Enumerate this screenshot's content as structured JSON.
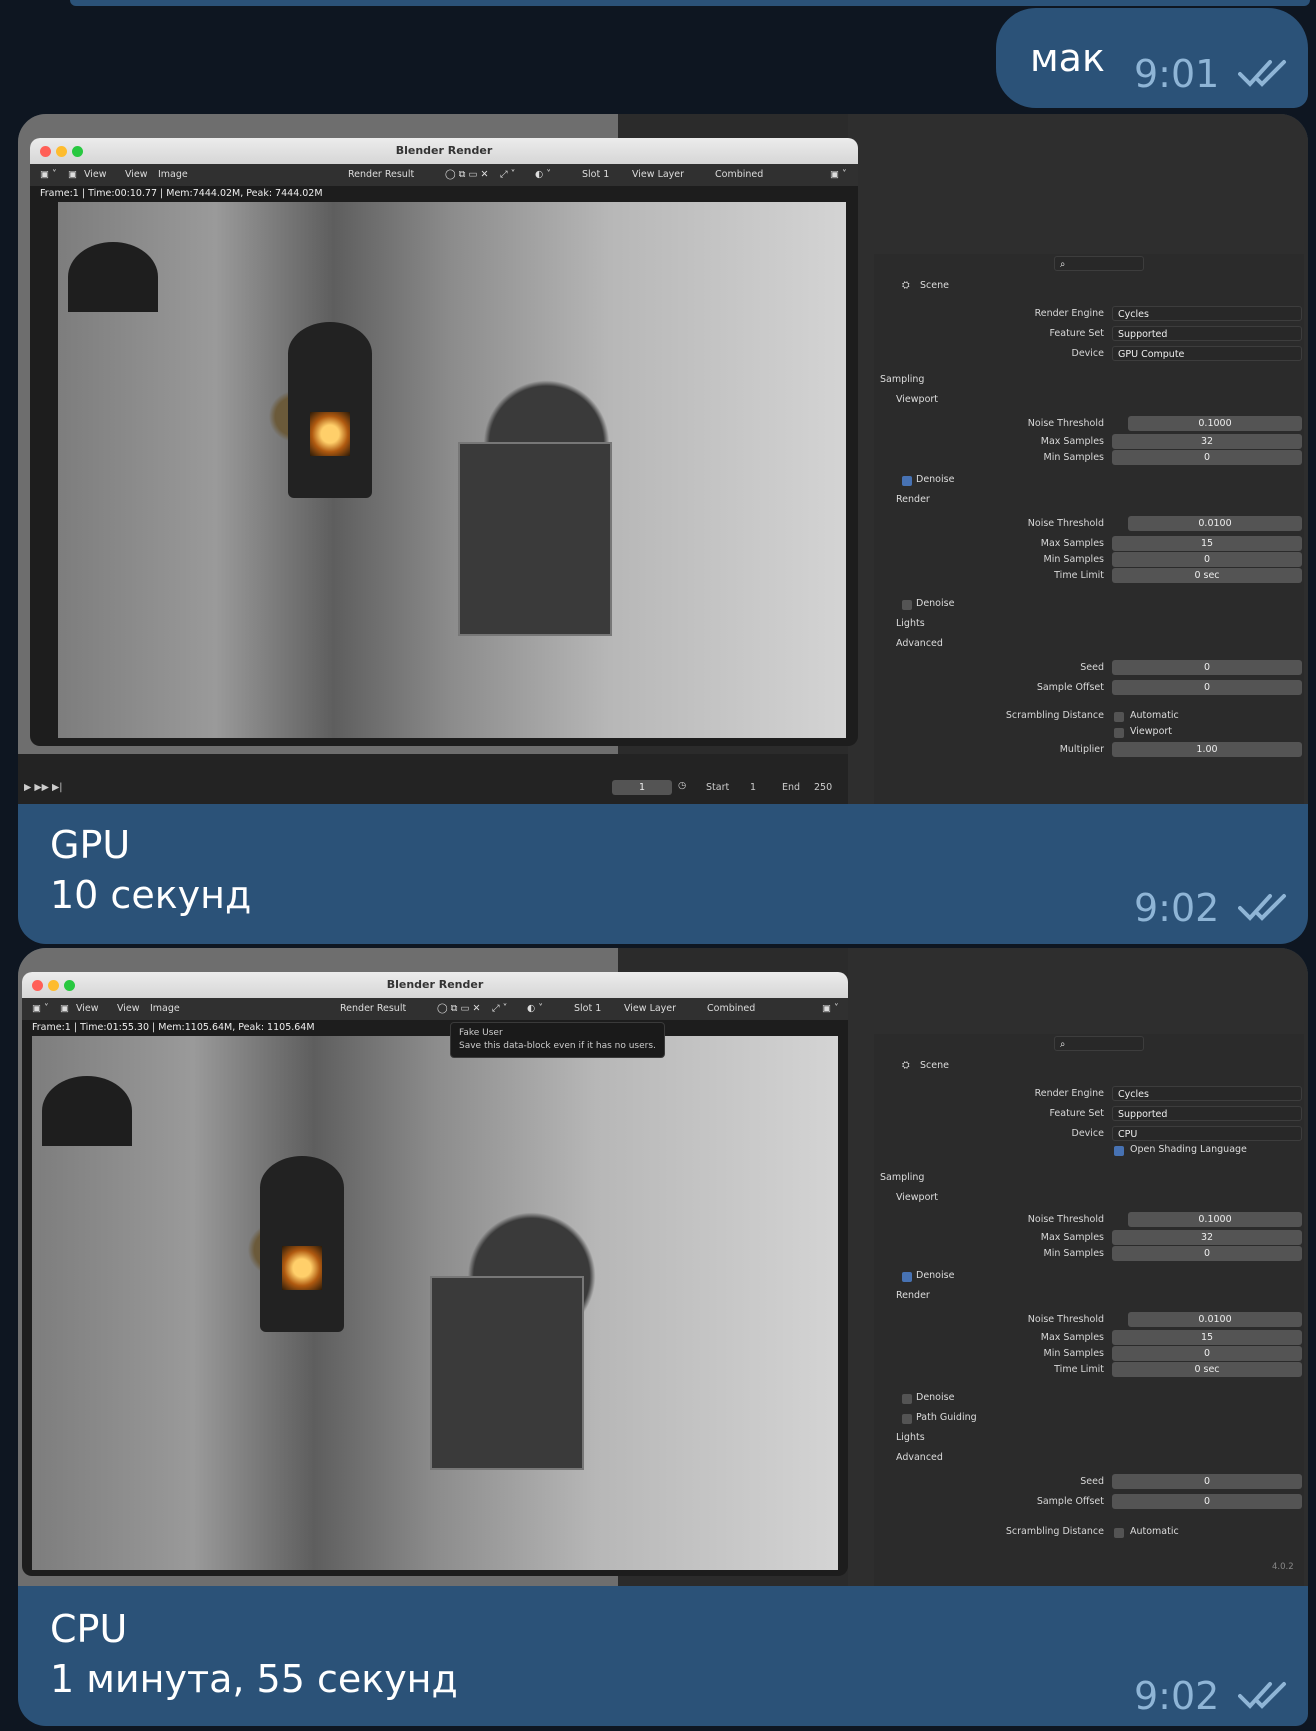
{
  "msg1": {
    "text": "мак",
    "time": "9:01"
  },
  "msg2": {
    "caption_line1": "GPU",
    "caption_line2": "10 секунд",
    "time": "9:02",
    "blender": {
      "window_title": "Blender Render",
      "menu_view": "View",
      "menu_view2": "View",
      "menu_image": "Image",
      "render_result": "Render Result",
      "slot": "Slot 1",
      "view_layer": "View Layer",
      "pass": "Combined",
      "info": "Frame:1 | Time:00:10.77 | Mem:7444.02M, Peak: 7444.02M",
      "scene": "Scene",
      "render_engine_label": "Render Engine",
      "render_engine": "Cycles",
      "feature_set_label": "Feature Set",
      "feature_set": "Supported",
      "device_label": "Device",
      "device": "GPU Compute",
      "sampling": "Sampling",
      "viewport": "Viewport",
      "noise_threshold_label": "Noise Threshold",
      "vp_noise": "0.1000",
      "max_samples_label": "Max Samples",
      "vp_max": "32",
      "min_samples_label": "Min Samples",
      "vp_min": "0",
      "denoise": "Denoise",
      "render": "Render",
      "r_noise": "0.0100",
      "r_max": "15",
      "r_min": "0",
      "time_limit_label": "Time Limit",
      "time_limit": "0 sec",
      "denoise2": "Denoise",
      "lights": "Lights",
      "advanced": "Advanced",
      "seed_label": "Seed",
      "seed": "0",
      "sample_offset_label": "Sample Offset",
      "sample_offset": "0",
      "scrambling_label": "Scrambling Distance",
      "automatic": "Automatic",
      "viewport_chk": "Viewport",
      "multiplier_label": "Multiplier",
      "multiplier": "1.00",
      "frame_current": "1",
      "start_label": "Start",
      "start": "1",
      "end_label": "End",
      "end": "250"
    }
  },
  "msg3": {
    "caption_line1": "CPU",
    "caption_line2": "1 минута, 55 секунд",
    "time": "9:02",
    "blender": {
      "window_title": "Blender Render",
      "menu_view": "View",
      "menu_view2": "View",
      "menu_image": "Image",
      "render_result": "Render Result",
      "slot": "Slot 1",
      "view_layer": "View Layer",
      "pass": "Combined",
      "info": "Frame:1 | Time:01:55.30 | Mem:1105.64M, Peak: 1105.64M",
      "tooltip_title": "Fake User",
      "tooltip_body": "Save this data-block even if it has no users.",
      "scene": "Scene",
      "render_engine_label": "Render Engine",
      "render_engine": "Cycles",
      "feature_set_label": "Feature Set",
      "feature_set": "Supported",
      "device_label": "Device",
      "device": "CPU",
      "osl": "Open Shading Language",
      "sampling": "Sampling",
      "viewport": "Viewport",
      "noise_threshold_label": "Noise Threshold",
      "vp_noise": "0.1000",
      "max_samples_label": "Max Samples",
      "vp_max": "32",
      "min_samples_label": "Min Samples",
      "vp_min": "0",
      "denoise": "Denoise",
      "render": "Render",
      "r_noise": "0.0100",
      "r_max": "15",
      "r_min": "0",
      "time_limit_label": "Time Limit",
      "time_limit": "0 sec",
      "denoise2": "Denoise",
      "path_guiding": "Path Guiding",
      "lights": "Lights",
      "advanced": "Advanced",
      "seed_label": "Seed",
      "seed": "0",
      "sample_offset_label": "Sample Offset",
      "sample_offset": "0",
      "scrambling_label": "Scrambling Distance",
      "automatic": "Automatic",
      "version": "4.0.2"
    }
  },
  "colors": {
    "bubble": "#2b5278",
    "background": "#0e1621",
    "time": "#8fb5d6",
    "blender_panel": "#2b2b2b",
    "checkbox": "#4772b3"
  }
}
